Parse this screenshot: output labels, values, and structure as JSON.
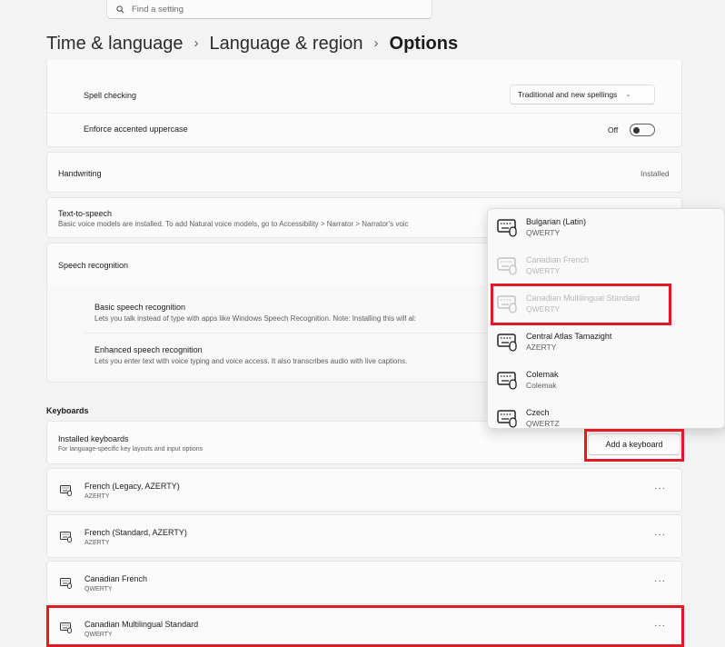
{
  "search": {
    "placeholder": "Find a setting"
  },
  "breadcrumb": {
    "part1": "Time & language",
    "part2": "Language & region",
    "current": "Options",
    "sep": "›"
  },
  "spell_checking": {
    "label": "Spell checking",
    "value": "Traditional and new spellings"
  },
  "accented": {
    "label": "Enforce accented uppercase",
    "state": "Off"
  },
  "handwriting": {
    "label": "Handwriting",
    "status": "Installed"
  },
  "tts": {
    "label": "Text-to-speech",
    "desc": "Basic voice models are installed. To add Natural voice models, go to Accessibility > Narrator > Narrator's voic"
  },
  "speech": {
    "label": "Speech recognition",
    "basic_label": "Basic speech recognition",
    "basic_desc": "Lets you talk instead of type with apps like Windows Speech Recognition. Note: Installing this will al:",
    "enhanced_label": "Enhanced speech recognition",
    "enhanced_desc": "Lets you enter text with voice typing and voice access. It also transcribes audio with live captions."
  },
  "keyboards": {
    "section": "Keyboards",
    "installed_label": "Installed keyboards",
    "installed_desc": "For language-specific key layouts and input options",
    "add_button": "Add a keyboard",
    "more": "···",
    "items": [
      {
        "name": "French (Legacy, AZERTY)",
        "layout": "AZERTY"
      },
      {
        "name": "French (Standard, AZERTY)",
        "layout": "AZERTY"
      },
      {
        "name": "Canadian French",
        "layout": "QWERTY"
      },
      {
        "name": "Canadian Multilingual Standard",
        "layout": "QWERTY"
      }
    ]
  },
  "popup": {
    "items": [
      {
        "name": "Bulgarian (Latin)",
        "layout": "QWERTY"
      },
      {
        "name": "Canadian French",
        "layout": "QWERTY"
      },
      {
        "name": "Canadian Multilingual Standard",
        "layout": "QWERTY"
      },
      {
        "name": "Central Atlas Tamazight",
        "layout": "AZERTY"
      },
      {
        "name": "Colemak",
        "layout": "Colemak"
      },
      {
        "name": "Czech",
        "layout": "QWERTZ"
      }
    ]
  },
  "colors": {
    "highlight": "#e21a24",
    "background": "#f3f3f3",
    "card": "#fbfbfb"
  }
}
